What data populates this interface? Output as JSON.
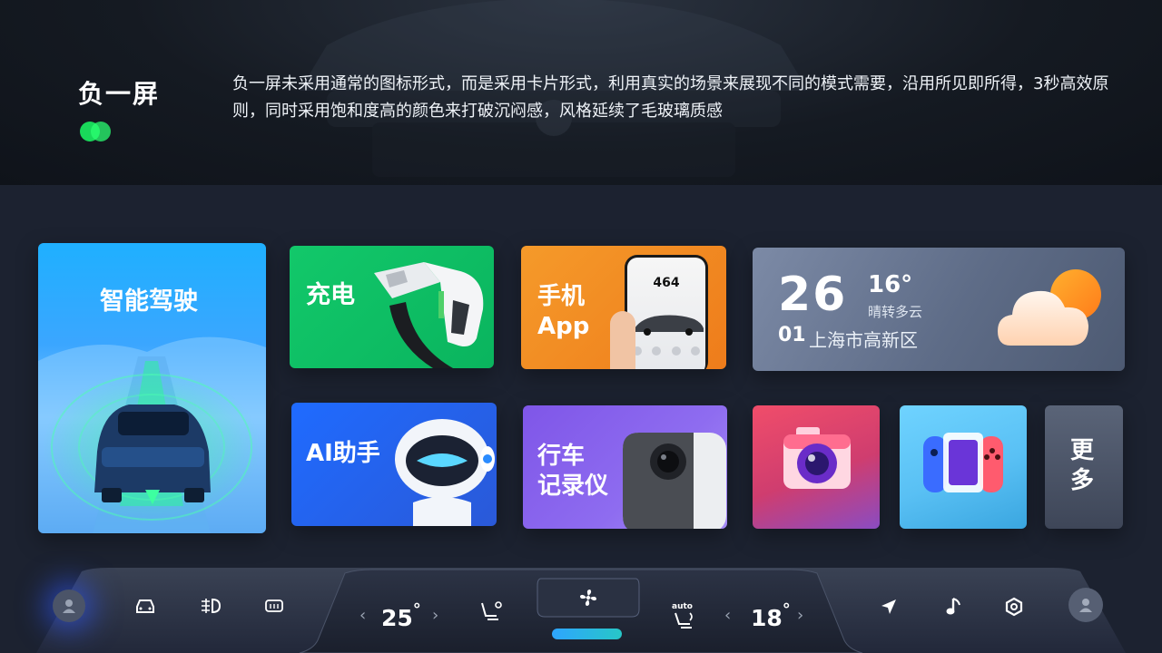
{
  "header": {
    "title": "负一屏",
    "description": "负一屏未采用通常的图标形式，而是采用卡片形式，利用真实的场景来展现不同的模式需要，沿用所见即所得，3秒高效原则，同时采用饱和度高的颜色来打破沉闷感，风格延续了毛玻璃质感",
    "brand_green": "#19d95a"
  },
  "cards": {
    "drive": {
      "label": "智能驾驶",
      "color": "#1fb0ff"
    },
    "charge": {
      "label": "充电",
      "color": "#12c86a"
    },
    "phone": {
      "label": "手机\nApp",
      "color": "#f59a2a",
      "screen_time": "464"
    },
    "weather": {
      "temp": "26",
      "range": "16°",
      "condition": "晴转多云",
      "date": "01",
      "location": "上海市高新区"
    },
    "ai": {
      "label": "AI助手",
      "color": "#1f6bff"
    },
    "dvr": {
      "label": "行车\n记录仪",
      "color": "#7f56e8"
    },
    "camera": {
      "icon": "camera-icon",
      "color": "#f04d6a"
    },
    "game": {
      "icon": "gamepad-icon",
      "color": "#59c0f4"
    },
    "more": {
      "label": "更多"
    }
  },
  "dock": {
    "left_temp": "25",
    "right_temp": "18",
    "deg": "°",
    "auto_label": "auto",
    "fan_indicator_color": "#2fb3ff",
    "icons": [
      "avatar-icon",
      "car-icon",
      "fog-light-icon",
      "rear-defrost-icon",
      "seat-heat-icon",
      "fan-icon",
      "seat-auto-icon",
      "navigation-icon",
      "music-note-icon",
      "settings-hex-icon",
      "avatar-icon"
    ]
  }
}
